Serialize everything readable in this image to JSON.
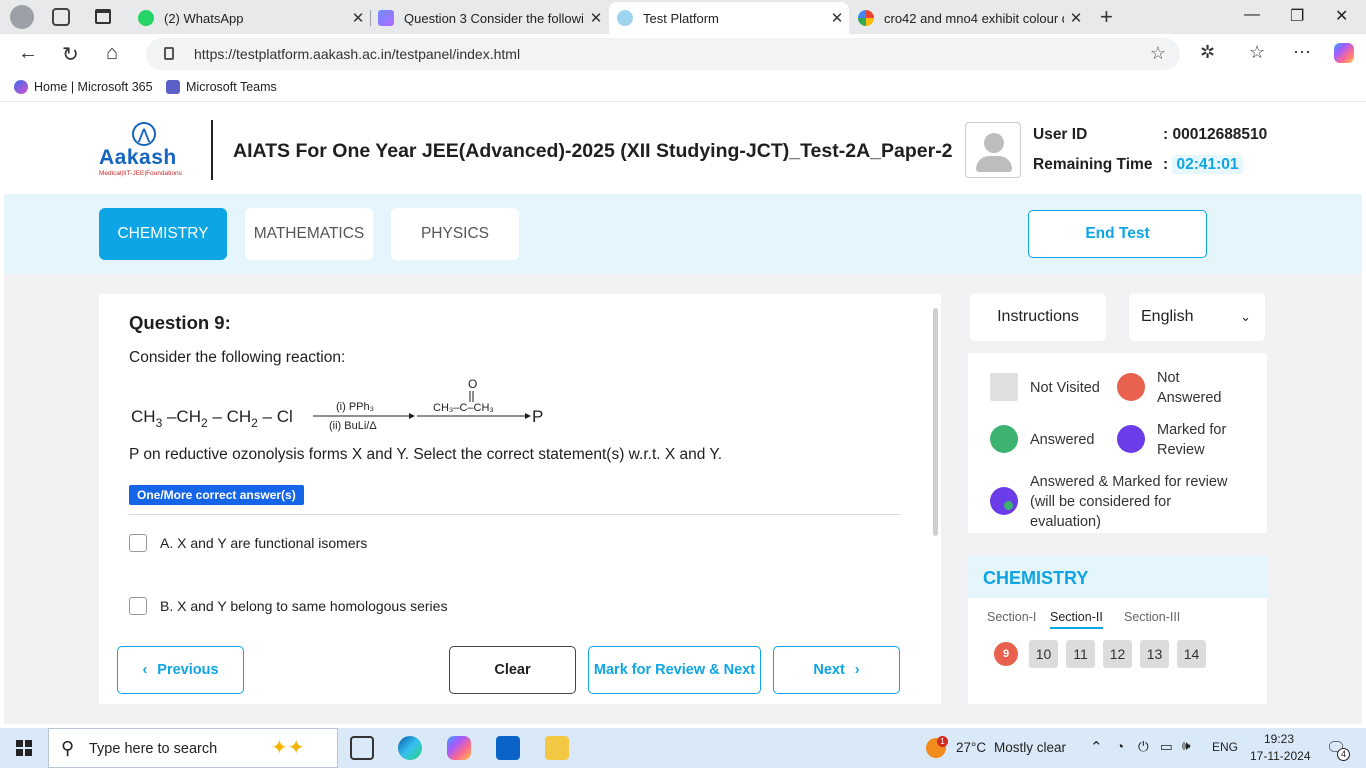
{
  "browser": {
    "tabs": [
      {
        "title": "(2) WhatsApp",
        "active": false
      },
      {
        "title": "Question 3 Consider the following",
        "active": false
      },
      {
        "title": "Test Platform",
        "active": true
      },
      {
        "title": "cro42 and mno4 exhibit colour du",
        "active": false
      }
    ],
    "url": "https://testplatform.aakash.ac.in/testpanel/index.html",
    "favorites": [
      "Home | Microsoft 365",
      "Microsoft Teams"
    ]
  },
  "header": {
    "logo_name": "Aakash",
    "logo_tagline": "Medical|IIT-JEE|Foundations",
    "test_title": "AIATS For One Year JEE(Advanced)-2025 (XII Studying-JCT)_Test-2A_Paper-2",
    "user_id_label": "User ID",
    "user_id_value": ": 00012688510",
    "time_label": "Remaining Time",
    "time_sep": ":",
    "time_value": "02:41:01"
  },
  "subjects": {
    "tabs": [
      "CHEMISTRY",
      "MATHEMATICS",
      "PHYSICS"
    ],
    "active": "CHEMISTRY",
    "end_test": "End Test"
  },
  "question": {
    "number": "Question 9:",
    "intro": "Consider the following reaction:",
    "reaction": {
      "reactant_parts": [
        "CH",
        "3",
        " –CH",
        "2",
        " – CH",
        "2",
        " – Cl"
      ],
      "arrow1_top": "(i) PPh₃",
      "arrow1_bottom": "(ii) BuLi/Δ",
      "ketone_o": "O",
      "ketone": "CH₃–C–CH₃",
      "product": "P"
    },
    "statement": "P on reductive ozonolysis forms X and Y. Select the correct statement(s) w.r.t. X and Y.",
    "type_badge": "One/More correct answer(s)",
    "options": [
      {
        "label": "A. X and Y are functional isomers"
      },
      {
        "label": "B. X and Y belong to same homologous series"
      }
    ]
  },
  "footer_buttons": {
    "previous": "Previous",
    "clear": "Clear",
    "mark_review_next": "Mark for Review & Next",
    "next": "Next"
  },
  "side": {
    "instructions": "Instructions",
    "language": "English",
    "legend": {
      "not_visited": "Not Visited",
      "not_answered_1": "Not",
      "not_answered_2": "Answered",
      "answered": "Answered",
      "marked_1": "Marked for",
      "marked_2": "Review",
      "ans_marked_1": "Answered & Marked for review",
      "ans_marked_2": "(will be considered for",
      "ans_marked_3": "evaluation)"
    },
    "palette": {
      "title": "CHEMISTRY",
      "sections": [
        "Section-I",
        "Section-II",
        "Section-III"
      ],
      "active_section": "Section-II",
      "questions": [
        "9",
        "10",
        "11",
        "12",
        "13",
        "14"
      ],
      "current": "9"
    }
  },
  "colors": {
    "accent": "#0da5e4",
    "not_answered": "#e8604e",
    "answered": "#3cb371",
    "marked": "#6a3de8",
    "not_visited": "#e0e0e0"
  },
  "taskbar": {
    "search_placeholder": "Type here to search",
    "weather_temp": "27°C",
    "weather_text": "Mostly clear",
    "weather_badge": "1",
    "lang": "ENG",
    "time": "19:23",
    "date": "17-11-2024",
    "notif_count": "4"
  }
}
